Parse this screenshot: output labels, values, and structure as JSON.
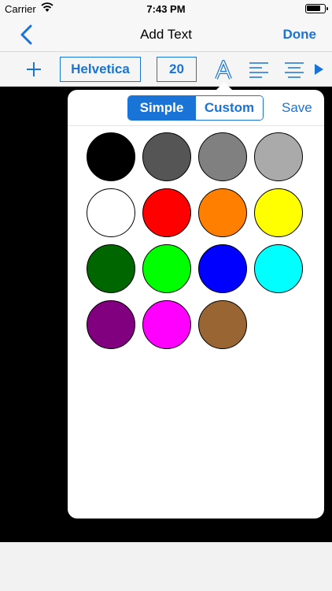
{
  "status_bar": {
    "carrier": "Carrier",
    "time": "7:43 PM",
    "battery_level": 0.8
  },
  "nav": {
    "back_icon": "chevron-left-icon",
    "title": "Add Text",
    "done_label": "Done"
  },
  "toolbar": {
    "add_icon": "plus-icon",
    "font_name": "Helvetica",
    "font_size": "20",
    "color_icon": "text-color-icon",
    "align_left_icon": "align-left-icon",
    "align_center_icon": "align-center-icon",
    "more_icon": "play-arrow-icon"
  },
  "color_picker": {
    "segments": [
      "Simple",
      "Custom"
    ],
    "selected_segment": "Simple",
    "save_label": "Save",
    "swatches": [
      "#000000",
      "#555555",
      "#808080",
      "#aaaaaa",
      "#ffffff",
      "#ff0000",
      "#ff8000",
      "#ffff00",
      "#006600",
      "#00ff00",
      "#0000ff",
      "#00ffff",
      "#800080",
      "#ff00ff",
      "#996633"
    ]
  },
  "colors": {
    "accent": "#1a73d6",
    "canvas": "#000000"
  }
}
